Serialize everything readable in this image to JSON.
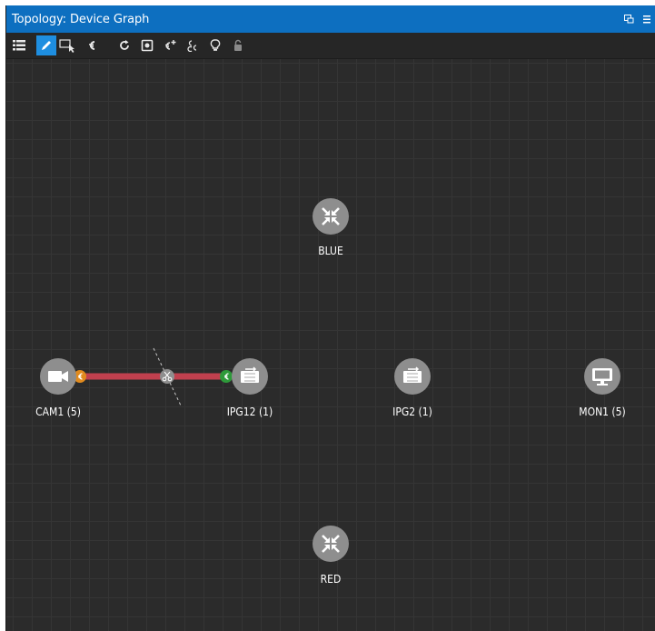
{
  "window": {
    "title": "Topology: Device Graph"
  },
  "toolbar": {
    "tools": [
      {
        "name": "list-view",
        "icon": "list-icon"
      },
      {
        "name": "edit",
        "icon": "pencil-icon",
        "active": true
      },
      {
        "name": "select",
        "icon": "select-cursor-icon"
      },
      {
        "name": "link",
        "icon": "link-icon"
      },
      {
        "name": "refresh",
        "icon": "refresh-icon"
      },
      {
        "name": "snapshot",
        "icon": "snapshot-icon"
      },
      {
        "name": "link-add",
        "icon": "link-add-icon"
      },
      {
        "name": "link-multi",
        "icon": "link-multi-icon"
      },
      {
        "name": "hint",
        "icon": "lightbulb-icon"
      },
      {
        "name": "lock",
        "icon": "lock-icon"
      }
    ]
  },
  "nodes": {
    "blue": {
      "label": "BLUE",
      "icon": "router-icon"
    },
    "red": {
      "label": "RED",
      "icon": "router-icon"
    },
    "cam1": {
      "label": "CAM1 (5)",
      "icon": "camera-icon"
    },
    "ipg12": {
      "label": "IPG12 (1)",
      "icon": "gateway-icon"
    },
    "ipg2": {
      "label": "IPG2 (1)",
      "icon": "gateway-icon"
    },
    "mon1": {
      "label": "MON1 (5)",
      "icon": "monitor-icon"
    }
  },
  "colors": {
    "titlebar": "#0d6fc0",
    "canvas": "#2b2b2b",
    "node_fill": "#8e8e8e",
    "link": "#c0404e",
    "port_source": "#e08a1e",
    "port_dest": "#2e9a3a",
    "tool_active": "#1e8ee0"
  }
}
